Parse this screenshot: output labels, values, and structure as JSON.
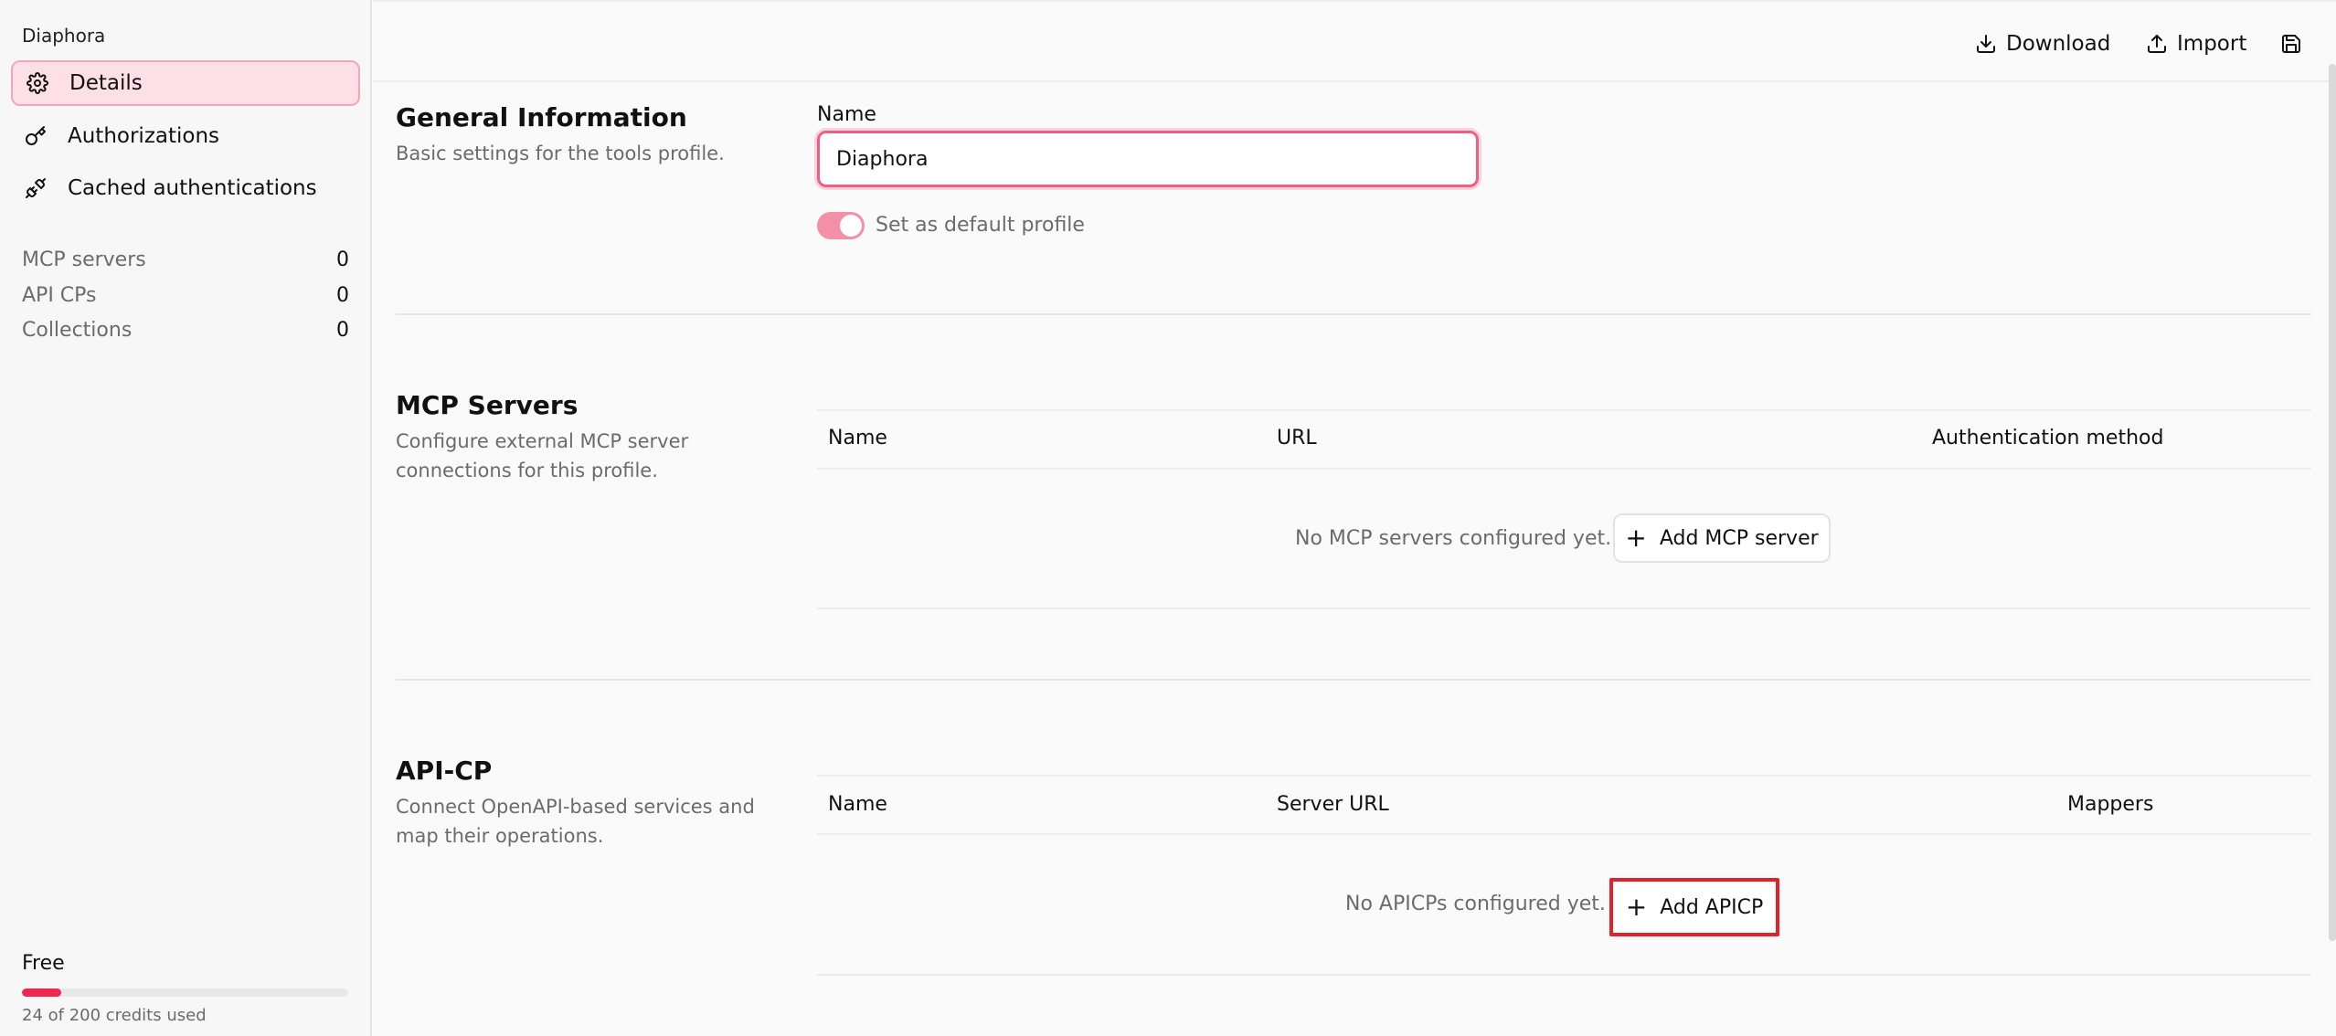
{
  "sidebar": {
    "workspace_name": "Diaphora",
    "nav": [
      {
        "label": "Details",
        "icon": "gear-icon",
        "active": true
      },
      {
        "label": "Authorizations",
        "icon": "key-icon",
        "active": false
      },
      {
        "label": "Cached authentications",
        "icon": "plug-icon",
        "active": false
      }
    ],
    "stats": [
      {
        "label": "MCP servers",
        "value": "0"
      },
      {
        "label": "API CPs",
        "value": "0"
      },
      {
        "label": "Collections",
        "value": "0"
      }
    ],
    "plan": {
      "name": "Free",
      "credits_text": "24 of 200 credits used",
      "used": 24,
      "total": 200
    }
  },
  "toolbar": {
    "download_label": "Download",
    "import_label": "Import",
    "save_icon": "save-icon"
  },
  "general": {
    "title": "General Information",
    "description": "Basic settings for the tools profile.",
    "name_label": "Name",
    "name_value": "Diaphora",
    "default_label": "Set as default profile",
    "default_on": true
  },
  "mcp": {
    "title": "MCP Servers",
    "description": "Configure external MCP server connections for this profile.",
    "columns": [
      "Name",
      "URL",
      "Authentication method"
    ],
    "empty_text": "No MCP servers configured yet.",
    "add_label": "Add MCP server"
  },
  "apicp": {
    "title": "API-CP",
    "description": "Connect OpenAPI-based services and map their operations.",
    "columns": [
      "Name",
      "Server URL",
      "Mappers"
    ],
    "empty_text": "No APICPs configured yet.",
    "add_label": "Add APICP"
  },
  "colors": {
    "accent": "#ec2752",
    "active_nav_bg": "#fde0e7",
    "highlight_border": "#e0222f"
  }
}
